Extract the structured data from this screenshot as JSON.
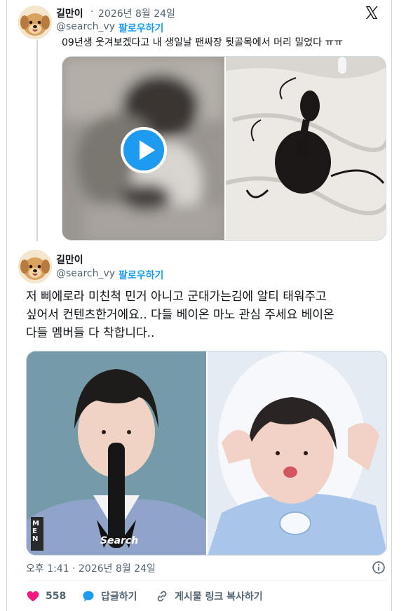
{
  "post1": {
    "name": "길만이",
    "date": "2026년 8월 24일",
    "handle": "@search_vy",
    "follow": "팔로우하기",
    "text": "09년생 웃겨보겠다고 내 생일날 팬싸장 뒷골목에서 머리 밀었다 ㅠㅠ"
  },
  "post2": {
    "name": "길만이",
    "handle": "@search_vy",
    "follow": "팔로우하기",
    "text_lines": [
      "저 삐에로라 미친척 민거 아니고 군대가는김에 알티 태워주고",
      "싶어서 컨텐츠한거에요.. 다들 베이온 마노 관심 주세요 베이온",
      "다들 멤버들 다 착합니다.."
    ],
    "timestamp": "오후 1:41 · 2026년 8월 24일",
    "actions": {
      "likes": "558",
      "reply": "답글하기",
      "copy_link": "게시물 링크 복사하기"
    },
    "image_overlay": {
      "left_tag": "MEN",
      "left_watermark": "Search"
    }
  },
  "colors": {
    "accent": "#1d9bf0",
    "like": "#f91880",
    "text": "#0f1419",
    "muted": "#536471",
    "border": "#cfd9de"
  },
  "icons": [
    "x-logo-icon",
    "play-icon",
    "info-icon",
    "heart-icon",
    "reply-icon",
    "link-icon",
    "avatar-dog"
  ]
}
